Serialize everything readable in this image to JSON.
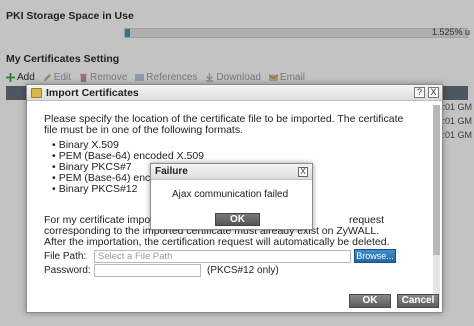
{
  "background": {
    "storage_section_title": "PKI Storage Space in Use",
    "storage_usage_text": "1.525% u",
    "storage_usage_percent": 1.525,
    "certificates_section_title": "My Certificates Setting",
    "toolbar": {
      "add": "Add",
      "edit": "Edit",
      "remove": "Remove",
      "references": "References",
      "download": "Download",
      "email": "Email"
    },
    "row_fragments": [
      ":01 GM",
      ":01 GM",
      ":01 GM"
    ],
    "left_fragments": [
      "1",
      "2"
    ]
  },
  "import_dialog": {
    "title": "Import Certificates",
    "help_label": "?",
    "close_label": "X",
    "intro": "Please specify the location of the certificate file to be imported. The certificate file must be in one of the following formats.",
    "formats": [
      "Binary X.509",
      "PEM (Base-64) encoded X.509",
      "Binary PKCS#7",
      "PEM (Base-64) encode",
      "Binary PKCS#12"
    ],
    "note_line1": "For my certificate importa",
    "note_line1_tail": "request",
    "note_line2": "corresponding to the imported certificate must already exist on ZyWALL.",
    "note_line3": "After the importation, the certification request will automatically be deleted.",
    "file_path_label": "File Path:",
    "file_path_placeholder": "Select a File Path",
    "browse_label": "Browse...",
    "password_label": "Password:",
    "password_value": "",
    "pkcs_note": "(PKCS#12 only)",
    "ok_label": "OK",
    "cancel_label": "Cancel"
  },
  "failure_dialog": {
    "title": "Failure",
    "close_label": "X",
    "message": "Ajax communication failed",
    "ok_label": "OK"
  },
  "colors": {
    "storage_fill": "#2f8fc4",
    "browse_button": "#2f7bc0",
    "dialog_button": "#6e6e6e",
    "table_header": "#5a6a79"
  }
}
